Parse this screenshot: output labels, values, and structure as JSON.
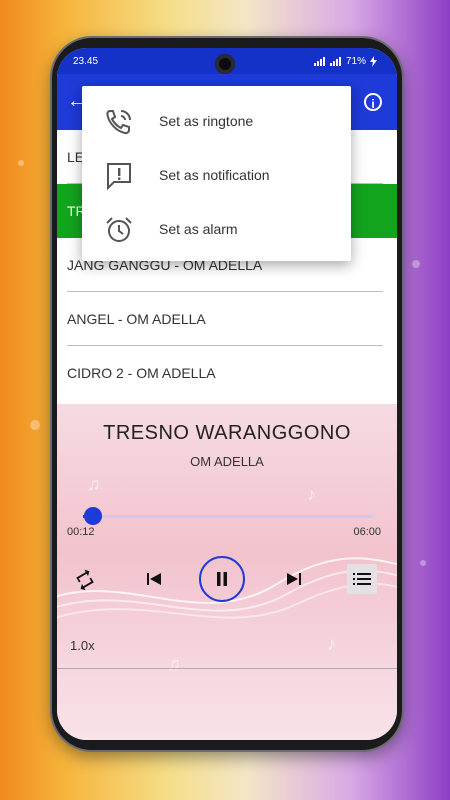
{
  "status_bar": {
    "time": "23.45",
    "battery": "71%"
  },
  "app_bar": {
    "back_icon": "arrow-back-icon",
    "info_icon": "info-icon"
  },
  "songs": [
    {
      "label": "LE"
    },
    {
      "label": "TR"
    },
    {
      "label": "JANG GANGGU - OM ADELLA"
    },
    {
      "label": "ANGEL - OM ADELLA"
    },
    {
      "label": "CIDRO 2 - OM ADELLA"
    }
  ],
  "selected_index": 1,
  "context_menu": {
    "items": [
      {
        "label": "Set as ringtone",
        "icon": "ringtone-icon"
      },
      {
        "label": "Set as notification",
        "icon": "notification-icon"
      },
      {
        "label": "Set as alarm",
        "icon": "alarm-icon"
      }
    ]
  },
  "player": {
    "title": "TRESNO WARANGGONO",
    "artist": "OM ADELLA",
    "current_time": "00:12",
    "total_time": "06:00",
    "progress_fraction": 0.033,
    "speed": "1.0x"
  },
  "colors": {
    "primary": "#1e3ad9",
    "selected_row": "#13a41d",
    "status_bar": "#1432c7"
  }
}
